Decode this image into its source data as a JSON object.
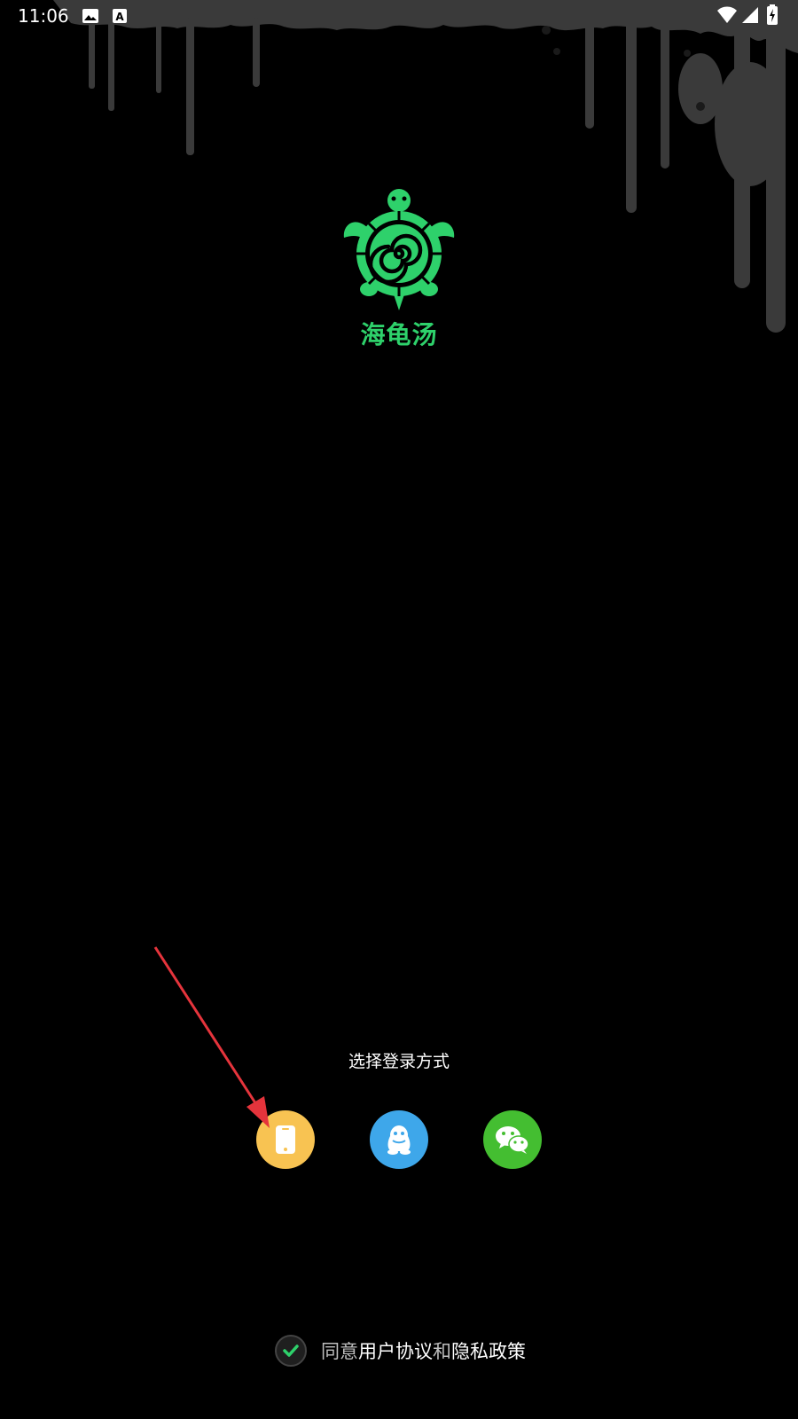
{
  "status_bar": {
    "time": "11:06",
    "icons": [
      "image-icon",
      "text-a-icon",
      "wifi-icon",
      "signal-icon",
      "battery-charging-icon"
    ]
  },
  "logo": {
    "name": "海龟汤",
    "color": "#2ed16b"
  },
  "login": {
    "label": "选择登录方式",
    "methods": [
      {
        "name": "phone",
        "icon": "phone-icon",
        "color": "#f8c352"
      },
      {
        "name": "qq",
        "icon": "qq-penguin-icon",
        "color": "#3ea7ea"
      },
      {
        "name": "wechat",
        "icon": "wechat-icon",
        "color": "#44be31"
      }
    ]
  },
  "agreement": {
    "prefix": "同意",
    "user_agreement": "用户协议",
    "conjunction": "和",
    "privacy_policy": "隐私政策",
    "checked": true
  },
  "annotation": {
    "color": "#e5343c",
    "icon": "red-arrow-annotation"
  }
}
